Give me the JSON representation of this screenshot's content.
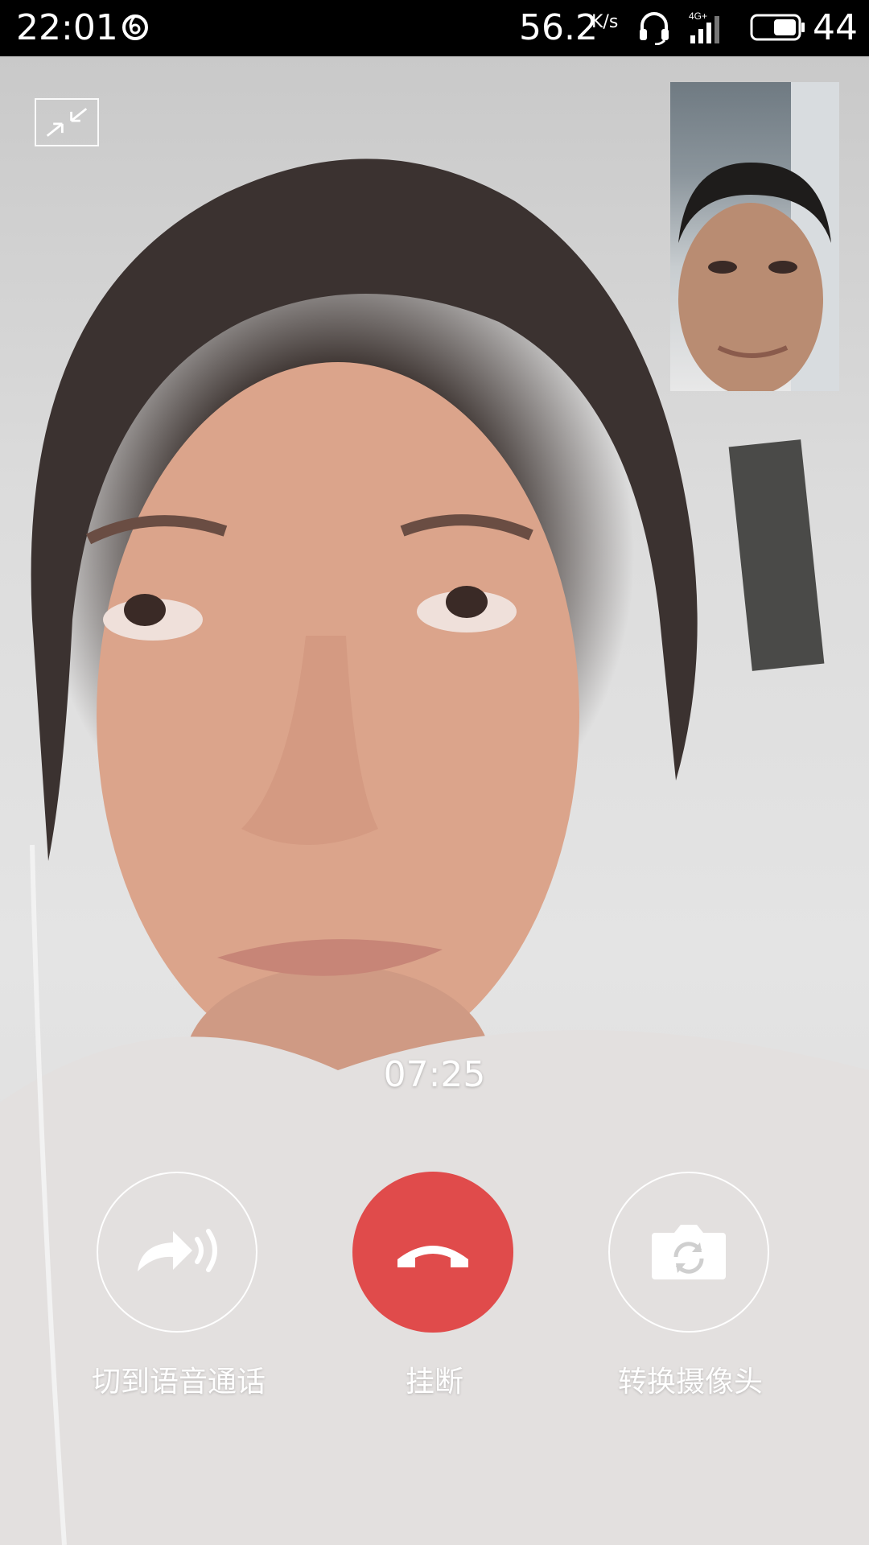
{
  "status_bar": {
    "time": "22:01",
    "network_speed": "56.2",
    "speed_unit": "K/s",
    "network_type": "4G+",
    "battery_level": "44"
  },
  "call": {
    "duration": "07:25"
  },
  "controls": {
    "switch_to_voice_label": "切到语音通话",
    "hangup_label": "挂断",
    "switch_camera_label": "转换摄像头"
  },
  "icons": {
    "minimize": "minimize-icon",
    "switch_to_voice": "voice-call-icon",
    "hangup": "hangup-icon",
    "switch_camera": "camera-switch-icon"
  },
  "colors": {
    "hangup_red": "#e04b4b",
    "status_bar_bg": "#000000",
    "overlay_text": "#ffffff"
  }
}
